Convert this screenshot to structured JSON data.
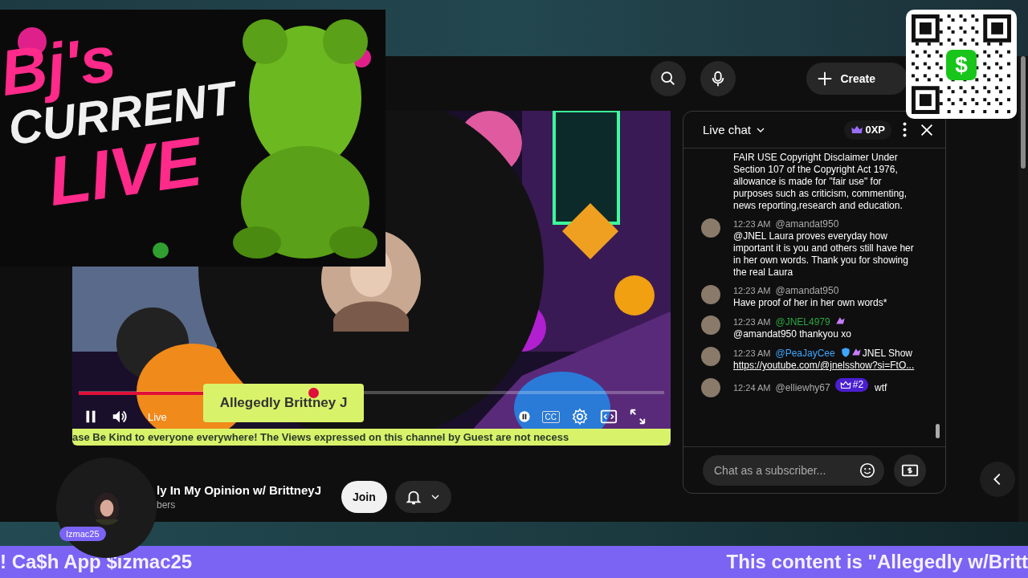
{
  "overlay_logo": {
    "lines": [
      "Bj's",
      "CURRENT",
      "LIVE"
    ]
  },
  "qr_code": {
    "symbol": "$"
  },
  "top_bar": {
    "create_label": "Create"
  },
  "video": {
    "lower_third": "Allegedly Brittney J",
    "ticker": "ase Be Kind to everyone everywhere! The Views expressed on this channel by Guest are not necess",
    "live_label": "Live",
    "cc_label": "CC",
    "progress": {
      "level": 0.4
    }
  },
  "channel": {
    "name": "ly In My Opinion w/ BrittneyJ",
    "subscribers": "bers",
    "join_label": "Join"
  },
  "avatar_overlay": {
    "badge": "Izmac25"
  },
  "live_chat": {
    "title": "Live chat",
    "xp": "0XP",
    "messages": [
      {
        "kind": "continued",
        "text": "FAIR USE Copyright Disclaimer Under Section 107 of the Copyright Act 1976, allowance is made for \"fair use\" for purposes such as criticism, commenting, news reporting,research and education."
      },
      {
        "kind": "message",
        "time": "12:23 AM",
        "author": "@amandat950",
        "color": "#aaaaaa",
        "verified": false,
        "text": "@JNEL Laura proves everyday how important it is you and others still have her in her own words. Thank you for showing the real Laura"
      },
      {
        "kind": "message",
        "time": "12:23 AM",
        "author": "@amandat950",
        "color": "#aaaaaa",
        "verified": false,
        "text": "Have proof of her in her own words*"
      },
      {
        "kind": "message",
        "time": "12:23 AM",
        "author": "@JNEL4979",
        "color": "#2ba640",
        "verified": false,
        "emote": true,
        "text": "@amandat950 thankyou xo"
      },
      {
        "kind": "message",
        "time": "12:23 AM",
        "author": "@PeaJayCee",
        "color": "#3ea6ff",
        "verified": true,
        "emote": true,
        "text": "JNEL Show",
        "link": "https://youtube.com/@jnelsshow?si=FtO..."
      },
      {
        "kind": "message",
        "time": "12:24 AM",
        "author": "@elliewhy67",
        "color": "#aaaaaa",
        "verified": false,
        "badge": "#2",
        "text": "wtf"
      }
    ],
    "input": {
      "placeholder": "Chat as a subscriber..."
    }
  },
  "bottom_ticker": [
    "! Ca$h App $izmac25",
    "This content is \"Allegedly w/Britt"
  ]
}
